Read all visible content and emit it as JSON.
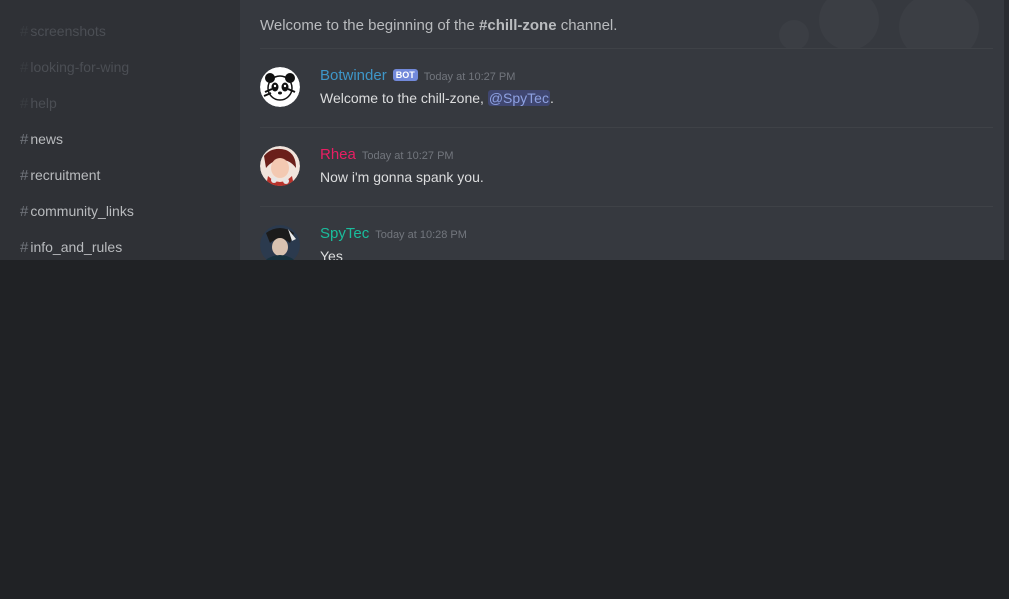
{
  "sidebar": {
    "channels": [
      {
        "hash": "#",
        "label": "screenshots"
      },
      {
        "hash": "#",
        "label": "looking-for-wing"
      },
      {
        "hash": "#",
        "label": "help"
      },
      {
        "hash": "#",
        "label": "news"
      },
      {
        "hash": "#",
        "label": "recruitment"
      },
      {
        "hash": "#",
        "label": "community_links"
      },
      {
        "hash": "#",
        "label": "info_and_rules"
      }
    ]
  },
  "channel_intro": {
    "prefix": "Welcome to the beginning of the ",
    "channel": "#chill-zone",
    "suffix": " channel."
  },
  "messages": [
    {
      "author": "Botwinder",
      "author_color": "#3e96c8",
      "badge": "BOT",
      "timestamp": "Today at 10:27 PM",
      "text_before": "Welcome to the chill-zone, ",
      "mention": "@SpyTec",
      "text_after": "."
    },
    {
      "author": "Rhea",
      "author_color": "#e91e63",
      "timestamp": "Today at 10:27 PM",
      "text": "Now i'm gonna spank you."
    },
    {
      "author": "SpyTec",
      "author_color": "#1abc9c",
      "timestamp": "Today at 10:28 PM",
      "text": "Yes"
    }
  ],
  "colors": {
    "sidebar_bg": "#2f3136",
    "chat_bg": "#36393f",
    "page_bg": "#202225",
    "bot_badge": "#7289da",
    "mention_text": "#8ea1e1"
  }
}
